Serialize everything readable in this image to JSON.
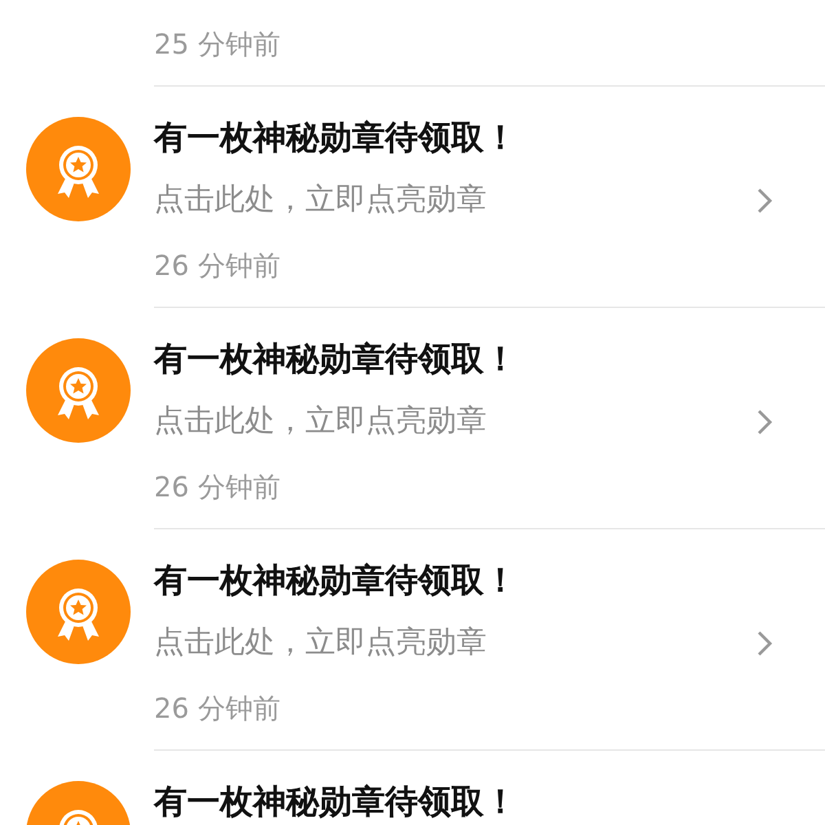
{
  "previous_item": {
    "time": "25 分钟前"
  },
  "notifications": [
    {
      "title": "有一枚神秘勋章待领取！",
      "subtitle": "点击此处，立即点亮勋章",
      "time": "26 分钟前"
    },
    {
      "title": "有一枚神秘勋章待领取！",
      "subtitle": "点击此处，立即点亮勋章",
      "time": "26 分钟前"
    },
    {
      "title": "有一枚神秘勋章待领取！",
      "subtitle": "点击此处，立即点亮勋章",
      "time": "26 分钟前"
    },
    {
      "title": "有一枚神秘勋章待领取！"
    }
  ]
}
